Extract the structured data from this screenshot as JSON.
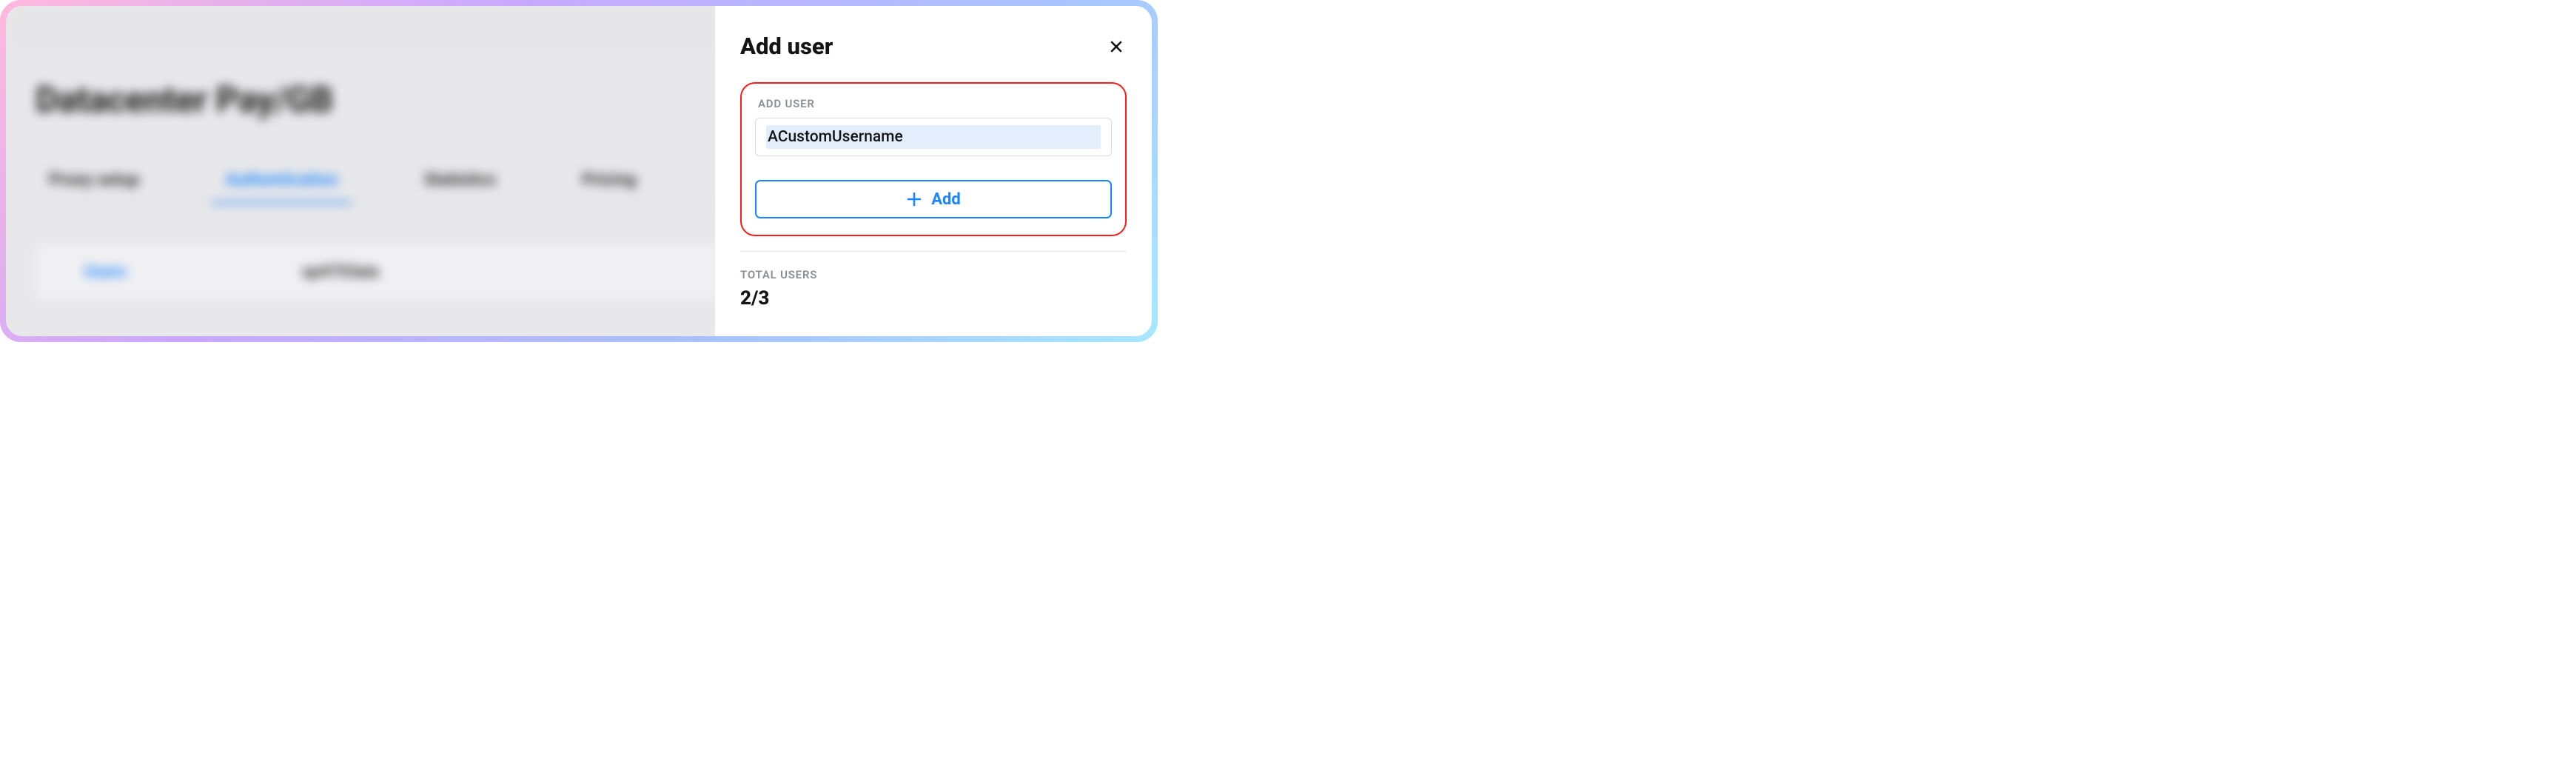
{
  "background": {
    "title": "Datacenter Pay/GB",
    "tabs": {
      "proxy_setup": "Proxy setup",
      "authentication": "Authentication",
      "statistics": "Statistics",
      "pricing": "Pricing"
    },
    "card": {
      "users_label": "Users",
      "value": "sp4753aia"
    }
  },
  "panel": {
    "title": "Add user",
    "field_label": "Add User",
    "input_value": "ACustomUsername",
    "add_button": "Add",
    "total_label": "Total Users",
    "total_value": "2/3"
  }
}
